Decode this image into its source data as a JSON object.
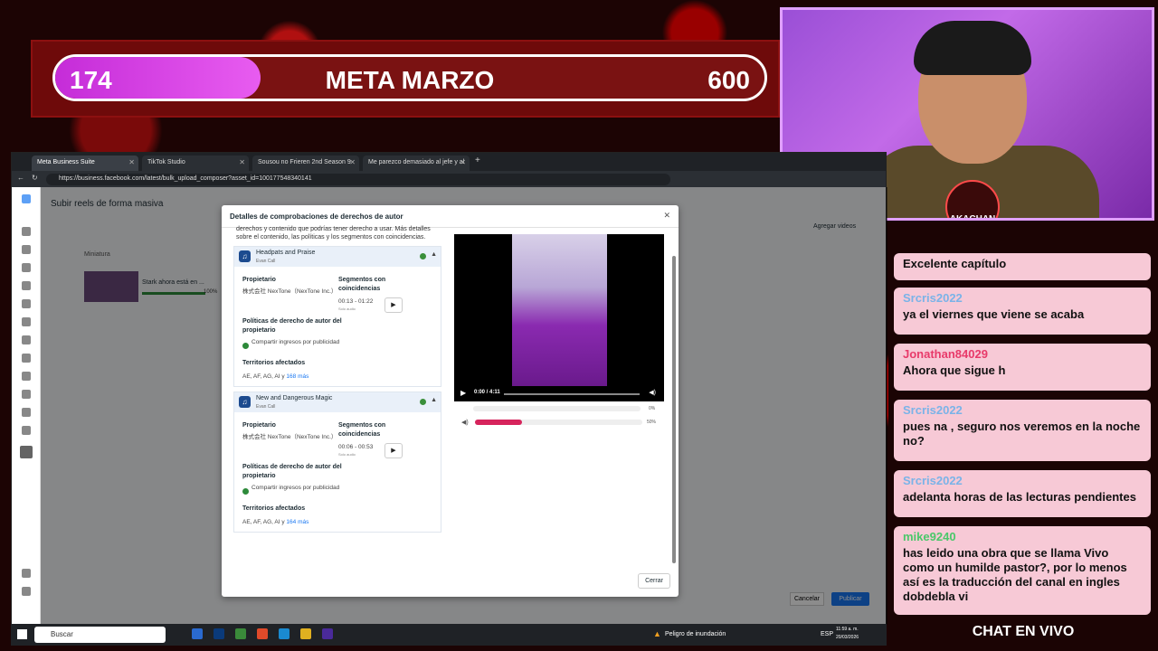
{
  "goal": {
    "current": "174",
    "title": "META MARZO",
    "target": "600",
    "progress_fraction": 0.29
  },
  "webcam": {
    "badge": "AKACHAN"
  },
  "chat": {
    "title": "CHAT EN VIVO",
    "messages": [
      {
        "user": "",
        "text": "Excelente capítulo",
        "color": "#222"
      },
      {
        "user": "Srcris2022",
        "text": "ya el viernes que viene se acaba",
        "color": "#7ab3e8"
      },
      {
        "user": "Jonathan84029",
        "text": "Ahora que sigue h",
        "color": "#e83a6a"
      },
      {
        "user": "Srcris2022",
        "text": "pues na , seguro nos veremos en la noche no?",
        "color": "#7ab3e8"
      },
      {
        "user": "Srcris2022",
        "text": "adelanta horas de las lecturas pendientes",
        "color": "#7ab3e8"
      },
      {
        "user": "mike9240",
        "text": "has leido una obra que se llama Vivo como un humilde pastor?, por lo menos así es la traducción del canal en ingles dobdebla vi",
        "color": "#4ac86a"
      }
    ]
  },
  "browser": {
    "tabs": [
      {
        "label": "Meta Business Suite"
      },
      {
        "label": "TikTok Studio"
      },
      {
        "label": "Sousou no Frieren 2nd Season 9"
      },
      {
        "label": "Me parezco demasiado al jefe y al"
      }
    ],
    "url": "https://business.facebook.com/latest/bulk_upload_composer?asset_id=100177548340141",
    "page_title": "Subir reels de forma masiva",
    "thumbnail_col": "Miniatura",
    "row_text": "Stark ahora está en ...",
    "row_pct": "100%",
    "add_videos": "Agregar videos",
    "cancel": "Cancelar",
    "publish": "Publicar"
  },
  "modal": {
    "title": "Detalles de comprobaciones de derechos de autor",
    "intro": "derechos y contenido que podrías tener derecho a usar. Más detalles sobre el contenido, las políticas y los segmentos con coincidencias.",
    "close_label": "Cerrar",
    "songs": [
      {
        "name": "Headpats and Praise",
        "artist": "Evan Call",
        "owner_label": "Propietario",
        "owner": "株式会社 NexTone（NexTone Inc.）",
        "segments_label": "Segmentos con coincidencias",
        "segment": "00:13 - 01:22",
        "segment_note": "Solo audio",
        "policy_label": "Políticas de derecho de autor del propietario",
        "policy": "Compartir ingresos por publicidad",
        "territories_label": "Territorios afectados",
        "territories": "AE, AF, AG, AI y ",
        "territories_more": "168 más"
      },
      {
        "name": "New and Dangerous Magic",
        "artist": "Evan Call",
        "owner_label": "Propietario",
        "owner": "株式会社 NexTone（NexTone Inc.）",
        "segments_label": "Segmentos con coincidencias",
        "segment": "00:06 - 00:53",
        "segment_note": "Solo audio",
        "policy_label": "Políticas de derecho de autor del propietario",
        "policy": "Compartir ingresos por publicidad",
        "territories_label": "Territorios afectados",
        "territories": "AE, AF, AG, AI y ",
        "territories_more": "164 más"
      }
    ],
    "video": {
      "time": "0:00 / 4:11",
      "meter1_pct": "0%",
      "meter2_pct": "50%",
      "meter2_fraction": 0.28
    }
  },
  "taskbar": {
    "search": "Buscar",
    "alert": "Peligro de inundación",
    "lang": "ESP",
    "time": "11:59 a. m.",
    "date": "20/03/2026"
  }
}
